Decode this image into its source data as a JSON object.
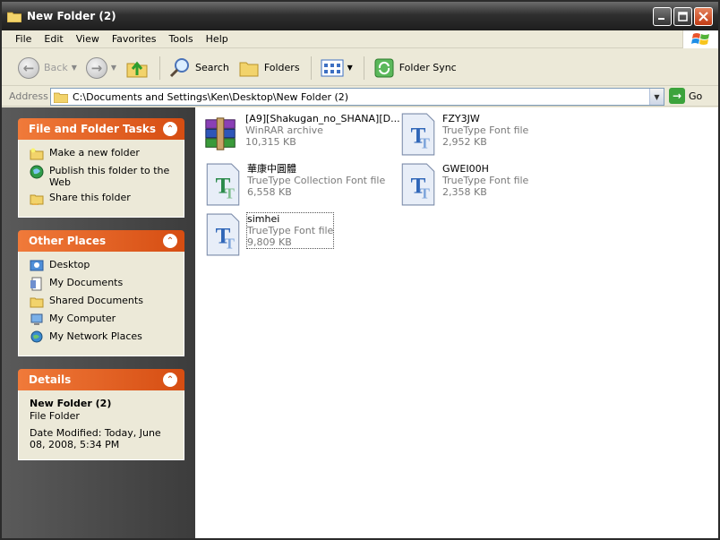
{
  "window": {
    "title": "New Folder (2)"
  },
  "menu": [
    "File",
    "Edit",
    "View",
    "Favorites",
    "Tools",
    "Help"
  ],
  "toolbar": {
    "back": "Back",
    "search": "Search",
    "folders": "Folders",
    "folder_sync": "Folder Sync"
  },
  "address": {
    "label": "Address",
    "path": "C:\\Documents and Settings\\Ken\\Desktop\\New Folder (2)",
    "go": "Go"
  },
  "tasks": {
    "file_folder": {
      "title": "File and Folder Tasks",
      "items": [
        "Make a new folder",
        "Publish this folder to the Web",
        "Share this folder"
      ]
    },
    "other_places": {
      "title": "Other Places",
      "items": [
        "Desktop",
        "My Documents",
        "Shared Documents",
        "My Computer",
        "My Network Places"
      ]
    },
    "details": {
      "title": "Details",
      "name": "New Folder (2)",
      "type": "File Folder",
      "modified": "Date Modified: Today, June 08, 2008, 5:34 PM"
    }
  },
  "files": [
    {
      "name": "[A9][Shakugan_no_SHANA][D...",
      "type": "WinRAR archive",
      "size": "10,315 KB",
      "icon": "winrar-archive-icon"
    },
    {
      "name": "FZY3JW",
      "type": "TrueType Font file",
      "size": "2,952 KB",
      "icon": "truetype-font-icon"
    },
    {
      "name": "華康中圓體",
      "type": "TrueType Collection Font file",
      "size": "6,558 KB",
      "icon": "truetype-collection-icon"
    },
    {
      "name": "GWEI00H",
      "type": "TrueType Font file",
      "size": "2,358 KB",
      "icon": "truetype-font-icon"
    },
    {
      "name": "simhei",
      "type": "TrueType Font file",
      "size": "9,809 KB",
      "icon": "truetype-font-icon"
    }
  ],
  "colors": {
    "panel_header": "#e0601f",
    "task_pane_bg": "#4a4a4a",
    "title_bar": "#2f2f2f"
  }
}
